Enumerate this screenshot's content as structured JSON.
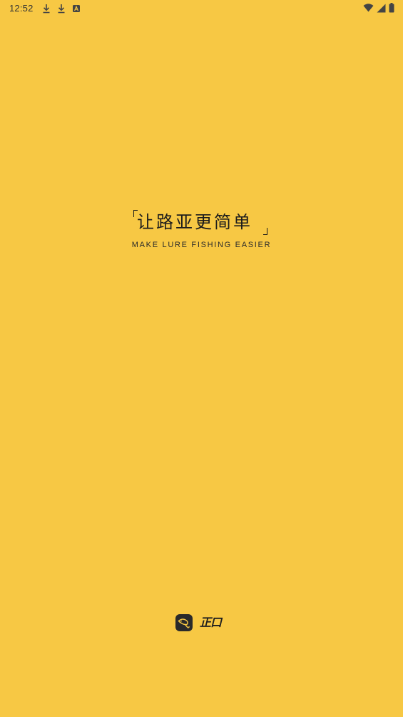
{
  "theme": {
    "background": "#F7C844",
    "text_dark": "#1C1C1C"
  },
  "status_bar": {
    "time": "12:52",
    "left_icons": [
      "download-icon",
      "download-icon",
      "app-notification-icon"
    ],
    "right_icons": [
      "wifi-icon",
      "cellular-signal-icon",
      "battery-icon"
    ]
  },
  "splash": {
    "slogan_cn": "让路亚更简单",
    "slogan_en": "MAKE LURE FISHING EASIER"
  },
  "brand": {
    "logo_icon": "fishing-lure-logo-icon",
    "name": "正口"
  }
}
